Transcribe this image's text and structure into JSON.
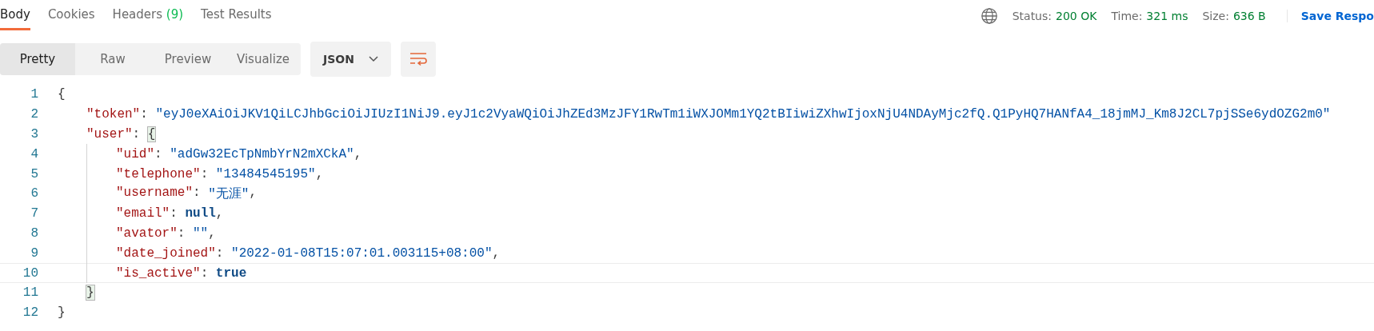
{
  "tabs": [
    {
      "label": "Body",
      "selected": true
    },
    {
      "label": "Cookies",
      "selected": false
    },
    {
      "label": "Headers",
      "count": "(9)",
      "selected": false
    },
    {
      "label": "Test Results",
      "selected": false
    }
  ],
  "response_meta": [
    {
      "label": "Status:",
      "value": "200 OK"
    },
    {
      "label": "Time:",
      "value": "321 ms"
    },
    {
      "label": "Size:",
      "value": "636 B"
    }
  ],
  "save_button": "Save Respo",
  "view_modes": [
    {
      "label": "Pretty",
      "selected": true
    },
    {
      "label": "Raw",
      "selected": false
    },
    {
      "label": "Preview",
      "selected": false
    },
    {
      "label": "Visualize",
      "selected": false
    }
  ],
  "format_dropdown": "JSON",
  "code_lines": [
    {
      "number": "1",
      "current": false,
      "tokens": [
        {
          "kind": "punct",
          "text": "{",
          "matched": false
        }
      ],
      "children": [
        {
          "number": "2",
          "current": false,
          "tokens": [
            {
              "kind": "key",
              "text": "\"token\"",
              "matched": false
            },
            {
              "kind": "punct",
              "text": ": ",
              "matched": false
            },
            {
              "kind": "string",
              "text": "\"eyJ0eXAiOiJKV1QiLCJhbGciOiJIUzI1NiJ9.eyJ1c2VyaWQiOiJhZEd3MzJFY1RwTm1iWXJOMm1YQ2tBIiwiZXhwIjoxNjU4NDAyMjc2fQ.Q1PyHQ7HANfA4_18jmMJ_Km8J2CL7pjSSe6ydOZG2m0\"",
              "matched": false
            }
          ]
        },
        {
          "number": "3",
          "current": false,
          "tokens": [
            {
              "kind": "key",
              "text": "\"user\"",
              "matched": false
            },
            {
              "kind": "punct",
              "text": ": ",
              "matched": false
            },
            {
              "kind": "punct",
              "text": "{",
              "matched": true
            }
          ],
          "children": [
            {
              "number": "4",
              "current": false,
              "tokens": [
                {
                  "kind": "key",
                  "text": "\"uid\"",
                  "matched": false
                },
                {
                  "kind": "punct",
                  "text": ": ",
                  "matched": false
                },
                {
                  "kind": "string",
                  "text": "\"adGw32EcTpNmbYrN2mXCkA\"",
                  "matched": false
                },
                {
                  "kind": "punct",
                  "text": ",",
                  "matched": false
                }
              ]
            },
            {
              "number": "5",
              "current": false,
              "tokens": [
                {
                  "kind": "key",
                  "text": "\"telephone\"",
                  "matched": false
                },
                {
                  "kind": "punct",
                  "text": ": ",
                  "matched": false
                },
                {
                  "kind": "string",
                  "text": "\"13484545195\"",
                  "matched": false
                },
                {
                  "kind": "punct",
                  "text": ",",
                  "matched": false
                }
              ]
            },
            {
              "number": "6",
              "current": false,
              "tokens": [
                {
                  "kind": "key",
                  "text": "\"username\"",
                  "matched": false
                },
                {
                  "kind": "punct",
                  "text": ": ",
                  "matched": false
                },
                {
                  "kind": "string",
                  "text": "\"无涯\"",
                  "matched": false
                },
                {
                  "kind": "punct",
                  "text": ",",
                  "matched": false
                }
              ]
            },
            {
              "number": "7",
              "current": false,
              "tokens": [
                {
                  "kind": "key",
                  "text": "\"email\"",
                  "matched": false
                },
                {
                  "kind": "punct",
                  "text": ": ",
                  "matched": false
                },
                {
                  "kind": "keyword",
                  "text": "null",
                  "matched": false
                },
                {
                  "kind": "punct",
                  "text": ",",
                  "matched": false
                }
              ]
            },
            {
              "number": "8",
              "current": false,
              "tokens": [
                {
                  "kind": "key",
                  "text": "\"avator\"",
                  "matched": false
                },
                {
                  "kind": "punct",
                  "text": ": ",
                  "matched": false
                },
                {
                  "kind": "string",
                  "text": "\"\"",
                  "matched": false
                },
                {
                  "kind": "punct",
                  "text": ",",
                  "matched": false
                }
              ]
            },
            {
              "number": "9",
              "current": false,
              "tokens": [
                {
                  "kind": "key",
                  "text": "\"date_joined\"",
                  "matched": false
                },
                {
                  "kind": "punct",
                  "text": ": ",
                  "matched": false
                },
                {
                  "kind": "string",
                  "text": "\"2022-01-08T15:07:01.003115+08:00\"",
                  "matched": false
                },
                {
                  "kind": "punct",
                  "text": ",",
                  "matched": false
                }
              ]
            },
            {
              "number": "10",
              "current": true,
              "tokens": [
                {
                  "kind": "key",
                  "text": "\"is_active\"",
                  "matched": false
                },
                {
                  "kind": "punct",
                  "text": ": ",
                  "matched": false
                },
                {
                  "kind": "keyword",
                  "text": "true",
                  "matched": false
                }
              ]
            }
          ]
        },
        {
          "number": "11",
          "current": false,
          "tokens": [
            {
              "kind": "punct",
              "text": "}",
              "matched": true
            }
          ]
        }
      ]
    },
    {
      "number": "12",
      "current": false,
      "tokens": [
        {
          "kind": "punct",
          "text": "}",
          "matched": false
        }
      ]
    }
  ]
}
